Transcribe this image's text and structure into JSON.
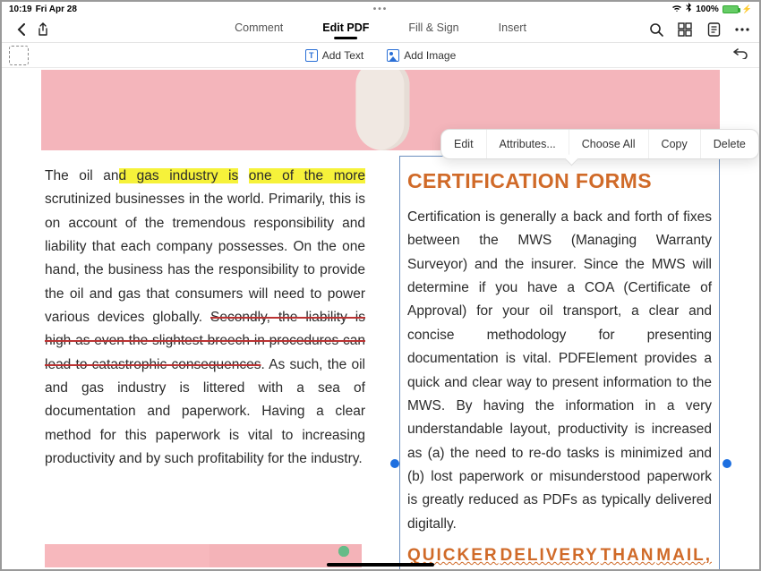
{
  "status": {
    "time": "10:19",
    "date": "Fri Apr 28",
    "battery_pct": "100%"
  },
  "tabs": {
    "comment": "Comment",
    "edit": "Edit PDF",
    "fillsign": "Fill & Sign",
    "insert": "Insert"
  },
  "tools": {
    "addtext": "Add Text",
    "addimage": "Add Image"
  },
  "ctx": {
    "edit": "Edit",
    "attrs": "Attributes...",
    "choose": "Choose All",
    "copy": "Copy",
    "del": "Delete"
  },
  "left": {
    "p_a": "The oil an",
    "p_b": "d gas industry is",
    "p_c": " ",
    "p_d": "one of the more",
    "p_e": " scrutinized businesses in the world. Primarily, this is on account of the tremendous responsibility and liability that each company possesses. On the one hand, the business has the responsibility to provide the oil and gas that consumers will need to power various devices globally. ",
    "p_f": "Secondly, the liability is high as even the slightest breech in procedures can lead to catastrophic consequences",
    "p_g": ". As such, the oil and gas industry is littered with a sea of documentation and paperwork. Having a clear method for this paperwork is vital to increasing productivity and by such profitability for the industry."
  },
  "right": {
    "head": "CERTIFICATION FORMS",
    "body": "Certification is generally a back and forth of fixes between the MWS (Managing Warranty Surveyor) and the insurer. Since the MWS will determine if you have a COA (Certificate of Approval) for your oil transport, a clear and concise methodology for presenting documentation is vital. PDFElement provides a quick and clear way to present information to the MWS. By having the information in a very understandable layout, productivity is increased as (a) the need to re-do tasks is minimized and (b) lost paperwork or misunderstood paperwork is greatly reduced as PDFs as typically delivered digitally.",
    "h2a": "QUICKER",
    "h2b": "DELIVERY",
    "h2c": "THAN",
    "h2d": "MAIL,"
  }
}
